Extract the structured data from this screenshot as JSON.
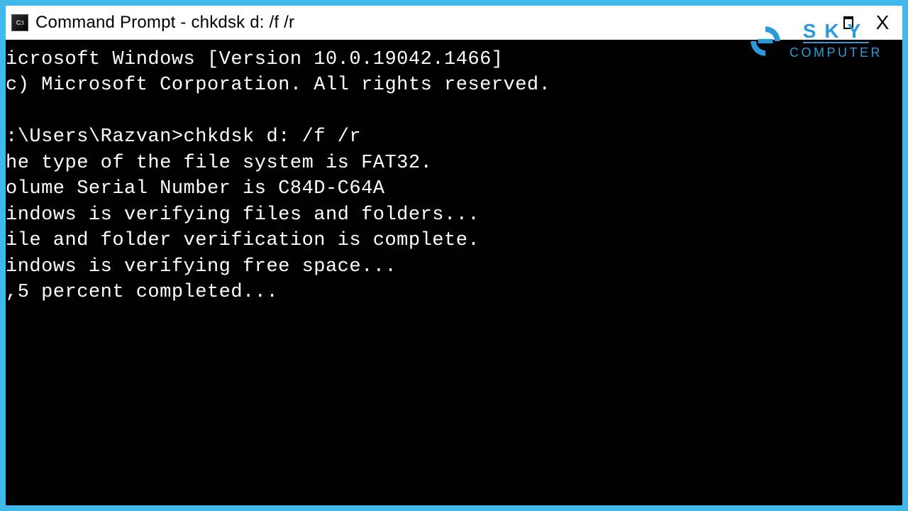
{
  "titlebar": {
    "icon_label": "C:\\",
    "title": "Command Prompt - chkdsk  d: /f /r",
    "maximize_label": "Maximize",
    "close_label": "X"
  },
  "terminal": {
    "lines": [
      "icrosoft Windows [Version 10.0.19042.1466]",
      "c) Microsoft Corporation. All rights reserved.",
      "",
      ":\\Users\\Razvan>chkdsk d: /f /r",
      "he type of the file system is FAT32.",
      "olume Serial Number is C84D-C64A",
      "indows is verifying files and folders...",
      "ile and folder verification is complete.",
      "indows is verifying free space...",
      ",5 percent completed..."
    ]
  },
  "logo": {
    "line1": "SKY",
    "line2": "COMPUTER",
    "accent_color": "#2a9bd8"
  }
}
